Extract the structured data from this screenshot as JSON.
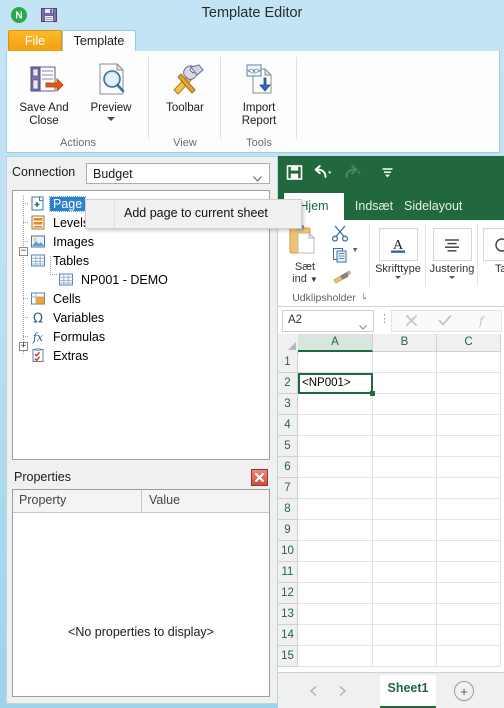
{
  "window": {
    "title": "Template Editor",
    "qat": [
      {
        "name": "app-logo-icon",
        "glyph": "N"
      },
      {
        "name": "save-icon",
        "glyph": "save"
      }
    ]
  },
  "tabs": [
    {
      "id": "file",
      "label": "File"
    },
    {
      "id": "template",
      "label": "Template"
    }
  ],
  "ribbon": {
    "groups": [
      {
        "name": "actions",
        "label": "Actions",
        "buttons": [
          {
            "name": "save-and-close",
            "label": "Save And\nClose",
            "icon": "save-export-icon",
            "dropdown": false
          },
          {
            "name": "preview",
            "label": "Preview",
            "icon": "preview-magnifier-icon",
            "dropdown": true
          }
        ]
      },
      {
        "name": "view",
        "label": "View",
        "buttons": [
          {
            "name": "toolbar",
            "label": "Toolbar",
            "icon": "tools-hammer-wrench-icon",
            "dropdown": false
          }
        ]
      },
      {
        "name": "tools",
        "label": "Tools",
        "buttons": [
          {
            "name": "import-report",
            "label": "Import\nReport",
            "icon": "import-xml-document-icon",
            "dropdown": false
          }
        ]
      }
    ]
  },
  "designer": {
    "connection": {
      "label": "Connection",
      "value": "Budget",
      "options": [
        "Budget"
      ]
    },
    "tree": [
      {
        "label": "Page",
        "icon": "page-add-icon",
        "indent": 1,
        "selected": true,
        "expander": null
      },
      {
        "label": "Levels",
        "icon": "levels-icon",
        "indent": 1,
        "selected": false,
        "expander": null
      },
      {
        "label": "Images",
        "icon": "images-icon",
        "indent": 1,
        "selected": false,
        "expander": null
      },
      {
        "label": "Tables",
        "icon": "table-icon",
        "indent": 1,
        "selected": false,
        "expander": "minus"
      },
      {
        "label": "NP001 - DEMO",
        "icon": "table-icon",
        "indent": 2,
        "selected": false,
        "expander": null
      },
      {
        "label": "Cells",
        "icon": "cells-icon",
        "indent": 1,
        "selected": false,
        "expander": null
      },
      {
        "label": "Variables",
        "icon": "omega-icon",
        "indent": 1,
        "selected": false,
        "expander": null
      },
      {
        "label": "Formulas",
        "icon": "fx-icon",
        "indent": 1,
        "selected": false,
        "expander": null
      },
      {
        "label": "Extras",
        "icon": "extras-checklist-icon",
        "indent": 1,
        "selected": false,
        "expander": "plus"
      }
    ],
    "context_menu": {
      "items": [
        {
          "label": "Add page to current sheet"
        }
      ]
    },
    "properties": {
      "title": "Properties",
      "close_label": "✕",
      "columns": [
        "Property",
        "Value"
      ],
      "empty_text": "<No properties to display>",
      "rows": []
    }
  },
  "excel": {
    "qat": [
      {
        "name": "save-icon",
        "label": "Save",
        "enabled": true,
        "dropdown": false
      },
      {
        "name": "undo-icon",
        "label": "Undo",
        "enabled": true,
        "dropdown": true
      },
      {
        "name": "redo-icon",
        "label": "Redo",
        "enabled": false,
        "dropdown": true
      },
      {
        "name": "customize-qat-icon",
        "label": "Customize Quick Access Toolbar",
        "enabled": true,
        "dropdown": false
      }
    ],
    "tabs": [
      {
        "id": "home",
        "label": "Hjem",
        "active": true
      },
      {
        "id": "insert",
        "label": "Indsæt",
        "active": false
      },
      {
        "id": "pagelayout",
        "label": "Sidelayout",
        "active": false
      }
    ],
    "ribbon_groups": [
      {
        "name": "clipboard",
        "label": "Udklipsholder",
        "paste_label": "Sæt\nind",
        "buttons": [
          {
            "name": "paste-button",
            "label": "Sæt ind",
            "icon": "clipboard-paste-icon"
          },
          {
            "name": "cut-button",
            "label": "Klip",
            "icon": "scissors-icon"
          },
          {
            "name": "copy-button",
            "label": "Kopiér",
            "icon": "copy-icon"
          },
          {
            "name": "format-painter-button",
            "label": "Formatpensel",
            "icon": "format-painter-icon"
          }
        ],
        "has_dialog_launcher": true
      },
      {
        "name": "font",
        "label": "Skrifttype",
        "buttons": [
          {
            "name": "font-button",
            "label": "Skrifttype",
            "icon": "font-a-icon"
          }
        ],
        "dropdown": true
      },
      {
        "name": "alignment",
        "label": "Justering",
        "buttons": [
          {
            "name": "alignment-button",
            "label": "Justering",
            "icon": "align-lines-icon"
          }
        ],
        "dropdown": true
      },
      {
        "name": "number",
        "label": "Tal",
        "buttons": [
          {
            "name": "number-button",
            "label": "Tal",
            "icon": "number-icon"
          }
        ],
        "dropdown": true
      }
    ],
    "formula_bar": {
      "name_box": "A2",
      "cancel_icon": "cancel-x-icon",
      "confirm_icon": "confirm-check-icon",
      "function_icon": "insert-function-fx-icon",
      "value": ""
    },
    "grid": {
      "columns": [
        "A",
        "B",
        "C"
      ],
      "active_column": "A",
      "rows": [
        1,
        2,
        3,
        4,
        5,
        6,
        7,
        8,
        9,
        10,
        11,
        12,
        13,
        14,
        15
      ],
      "cells": [
        {
          "ref": "A2",
          "row": 2,
          "col": "A",
          "value": "<NP001>"
        }
      ],
      "selected_cell": "A2"
    },
    "sheet_bar": {
      "prev_icon": "nav-prev-icon",
      "next_icon": "nav-next-icon",
      "sheets": [
        {
          "name": "Sheet1",
          "active": true
        }
      ],
      "add_sheet_label": "+"
    }
  },
  "colors": {
    "title_gradient_top": "#c3e4f4",
    "title_gradient_bottom": "#9ed3ec",
    "file_tab_orange": "#f4a81d",
    "excel_green": "#21683f",
    "tree_selection_blue": "#2f7fd1"
  }
}
